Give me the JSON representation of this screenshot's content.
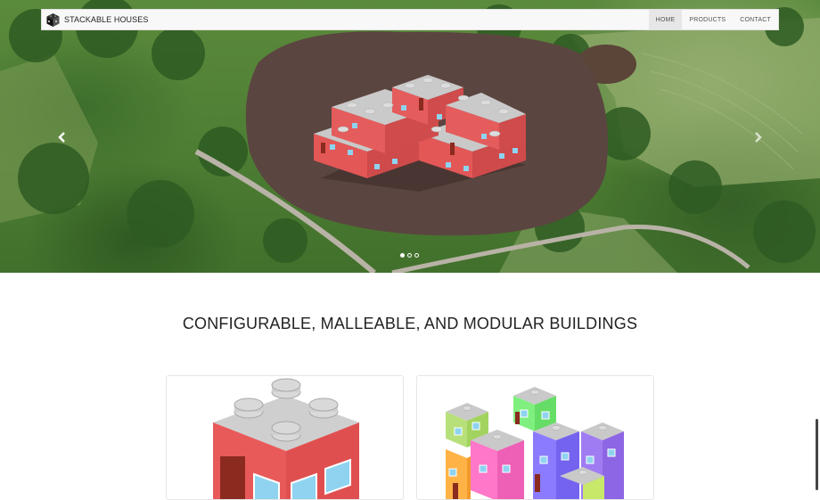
{
  "navbar": {
    "brand": "STACKABLE HOUSES",
    "items": [
      {
        "label": "HOME",
        "active": true
      },
      {
        "label": "PRODUCTS",
        "active": false
      },
      {
        "label": "CONTACT",
        "active": false
      }
    ]
  },
  "carousel": {
    "prev_icon": "chevron-left-icon",
    "next_icon": "chevron-right-icon",
    "indicator_count": 3,
    "active_index": 0
  },
  "main": {
    "headline": "CONFIGURABLE, MALLEABLE, AND MODULAR BUILDINGS"
  },
  "colors": {
    "house_red": "#e85a5a",
    "lego_gray": "#c8c8c8",
    "window_blue": "#8fd3f0"
  }
}
